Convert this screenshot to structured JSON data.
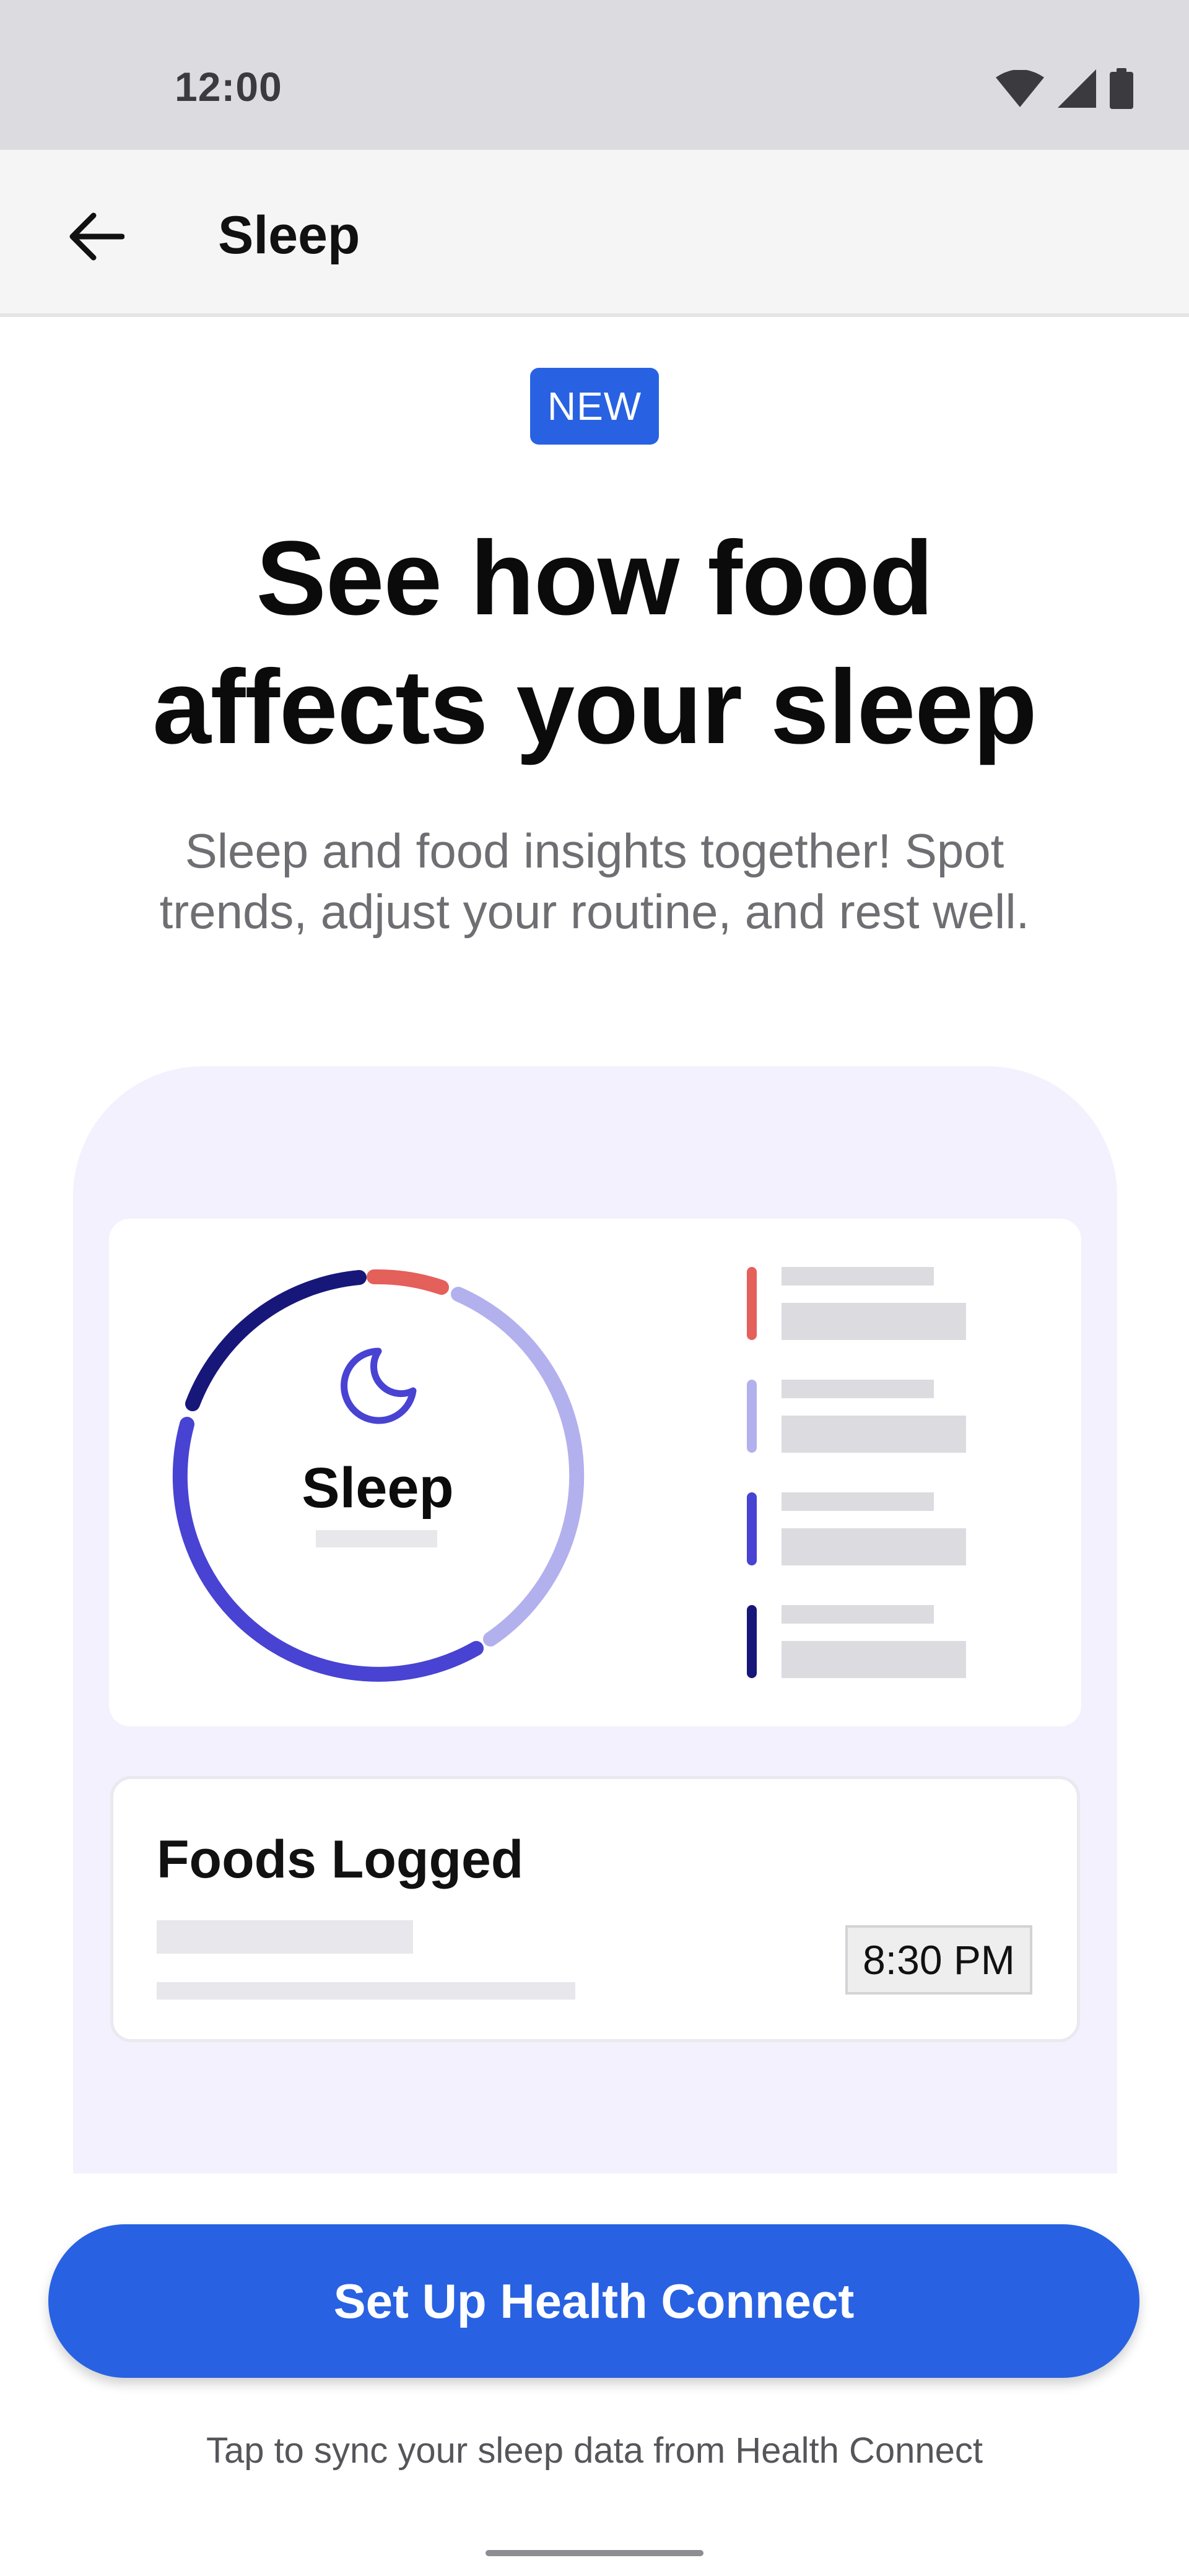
{
  "status_bar": {
    "time": "12:00",
    "icons": [
      "wifi-icon",
      "cellular-signal-icon",
      "battery-icon"
    ]
  },
  "app_bar": {
    "back_icon": "arrow-left-icon",
    "title": "Sleep"
  },
  "promo": {
    "badge": "NEW",
    "title_lines": [
      "See how food",
      "affects your sleep"
    ],
    "subtitle_lines": [
      "Sleep and food insights together! Spot",
      "trends, adjust your routine, and rest well."
    ]
  },
  "illustration": {
    "sleep_card": {
      "center_label": "Sleep",
      "center_icon": "moon-icon",
      "legend_colors": [
        "#e4605b",
        "#b3b0ee",
        "#4843d2",
        "#17177a"
      ]
    },
    "foods_card": {
      "title": "Foods Logged",
      "time": "8:30 PM"
    }
  },
  "cta": {
    "label": "Set Up Health Connect",
    "caption": "Tap to sync your sleep data from Health Connect"
  },
  "colors": {
    "accent": "#2862e2",
    "illustration_bg": "#f2f1fd"
  }
}
